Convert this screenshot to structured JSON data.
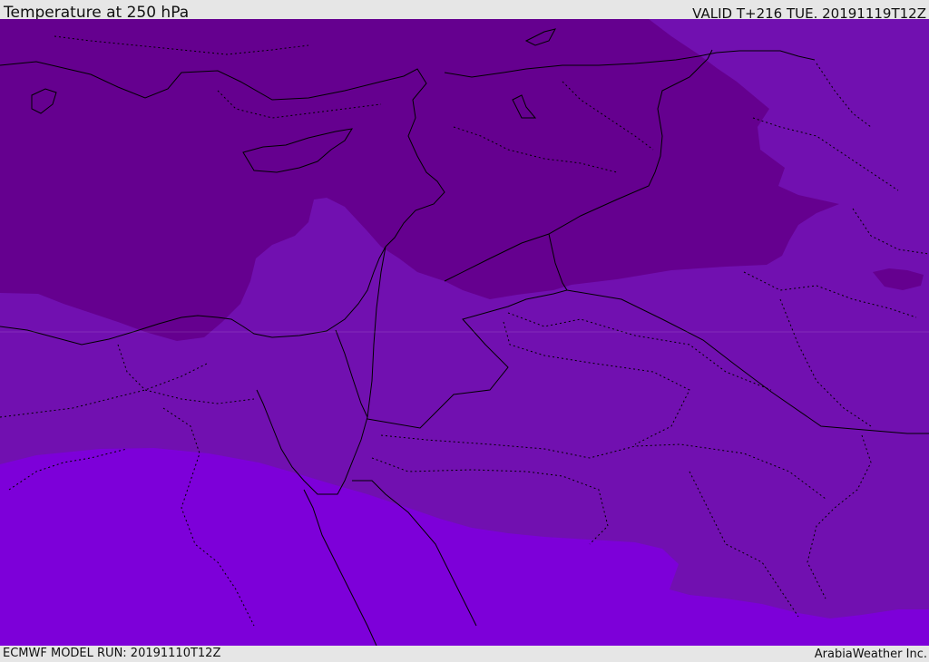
{
  "header": {
    "title": "Temperature at 250 hPa",
    "valid": "VALID T+216 TUE. 20191119T12Z"
  },
  "footer": {
    "model_run": "ECMWF MODEL RUN: 20191110T12Z",
    "credit": "ArabiaWeather Inc."
  },
  "map": {
    "fill_colors": {
      "coldest": "#65008f",
      "cold": "#7110b0",
      "mild": "#7d00d9"
    },
    "line_color": "#000000"
  }
}
